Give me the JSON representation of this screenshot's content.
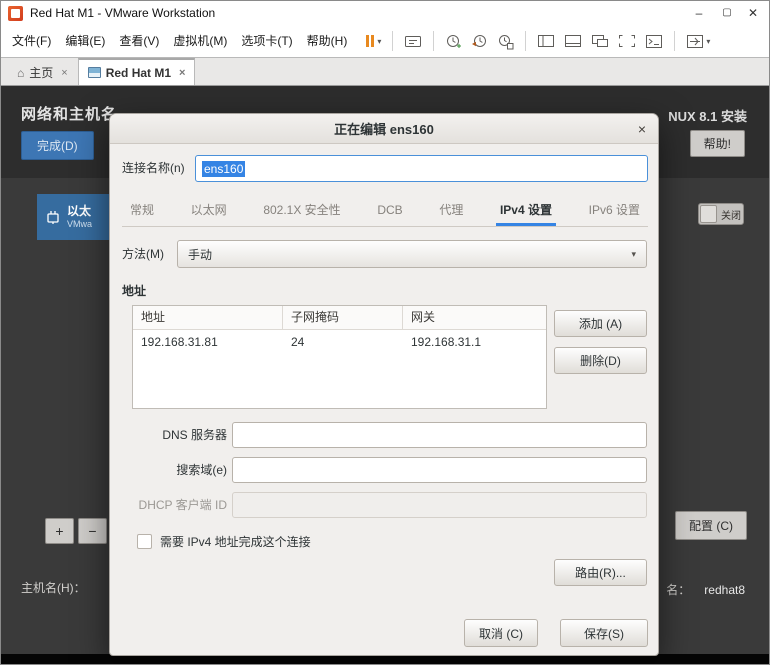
{
  "window": {
    "title": "Red Hat M1 - VMware Workstation",
    "minimize": "–",
    "maximize": "▢",
    "close": "✕"
  },
  "menubar": {
    "items": [
      "文件(F)",
      "编辑(E)",
      "查看(V)",
      "虚拟机(M)",
      "选项卡(T)",
      "帮助(H)"
    ]
  },
  "toolbar": {
    "icons": [
      "pause",
      "send-ctrl-alt-del",
      "snapshot-take",
      "snapshot-revert",
      "snapshot-manager",
      "show-library",
      "show-thumbnails",
      "unity-mode",
      "free-stretch",
      "console-view",
      "fullscreen"
    ]
  },
  "tabbar": {
    "tabs": [
      {
        "icon": "⌂",
        "label": "主页",
        "close": "×"
      },
      {
        "label": "Red Hat M1",
        "close": "×"
      }
    ]
  },
  "installer": {
    "title": "网络和主机名",
    "done": "完成(D)",
    "banner": "NUX 8.1 安装",
    "help": "帮助!",
    "device": {
      "name": "以太",
      "detail": "VMwa"
    },
    "switch_off": "关闭",
    "add": "+",
    "remove": "−",
    "configure": "配置 (C)",
    "hostname_label": "主机名(H)：",
    "hostname_suffix_label": "名：",
    "hostname_value": "redhat8"
  },
  "dialog": {
    "title": "正在编辑 ens160",
    "close": "×",
    "connection_name_label": "连接名称(n)",
    "connection_name_value": "ens160",
    "tabs": [
      "常规",
      "以太网",
      "802.1X 安全性",
      "DCB",
      "代理",
      "IPv4 设置",
      "IPv6 设置"
    ],
    "active_tab": "IPv4 设置",
    "method_label": "方法(M)",
    "method_value": "手动",
    "addresses_title": "地址",
    "table": {
      "headers": [
        "地址",
        "子网掩码",
        "网关"
      ],
      "rows": [
        [
          "192.168.31.81",
          "24",
          "192.168.31.1"
        ]
      ]
    },
    "add": "添加 (A)",
    "delete": "删除(D)",
    "dns_label": "DNS 服务器",
    "dns_value": "",
    "search_label": "搜索域(e)",
    "search_value": "",
    "dhcp_label": "DHCP 客户端 ID",
    "dhcp_value": "",
    "require_label": "需要 IPv4 地址完成这个连接",
    "routes": "路由(R)...",
    "cancel": "取消 (C)",
    "save": "保存(S)"
  },
  "colors": {
    "accent": "#3584e4",
    "anaconda_blue": "#3d76b4",
    "pause_orange": "#e8891f",
    "vm_background": "#3a3a3a"
  }
}
